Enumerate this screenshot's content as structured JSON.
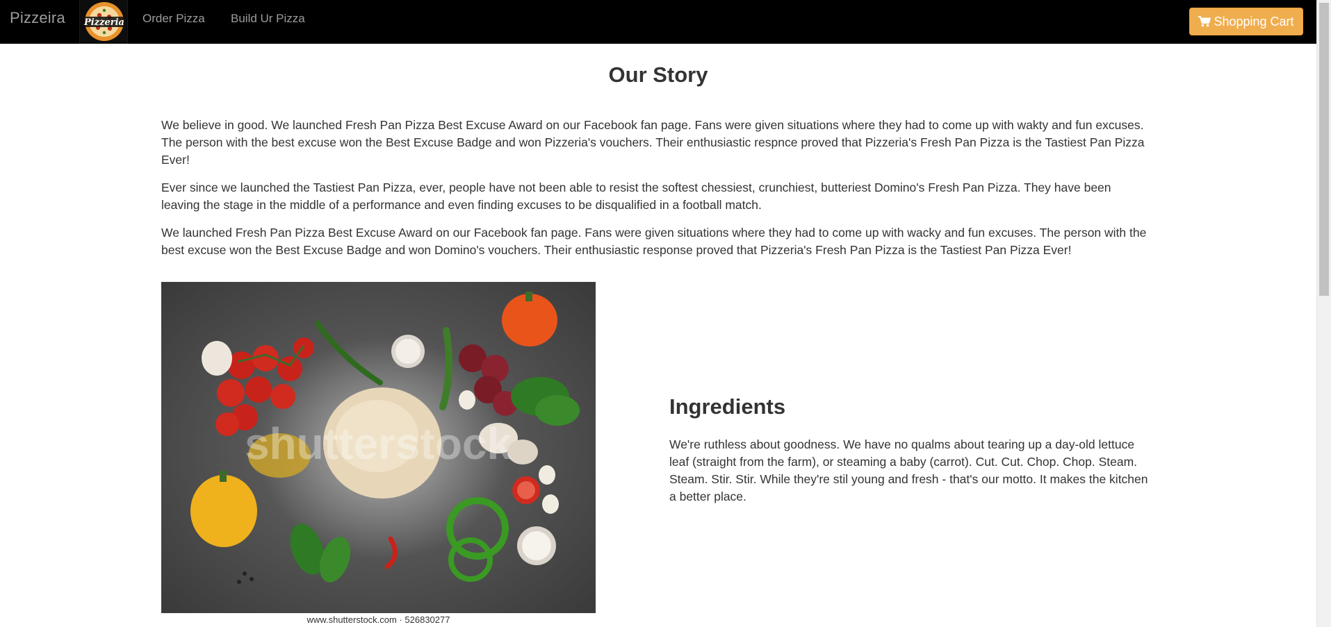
{
  "navbar": {
    "brand": "Pizzeira",
    "logo_text": "Pizzeria",
    "links": [
      "Order Pizza",
      "Build Ur Pizza"
    ],
    "cart_label": "Shopping Cart",
    "cart_icon": "shopping-cart-icon",
    "cart_color": "#f0ad4e"
  },
  "story": {
    "title": "Our Story",
    "paragraphs": [
      "We believe in good. We launched Fresh Pan Pizza Best Excuse Award on our Facebook fan page. Fans were given situations where they had to come up with wakty and fun excuses. The person with the best excuse won the Best Excuse Badge and won Pizzeria's vouchers. Their enthusiastic respnce proved that Pizzeria's Fresh Pan Pizza is the Tastiest Pan Pizza Ever!",
      "Ever since we launched the Tastiest Pan Pizza, ever, people have not been able to resist the softest chessiest, crunchiest, butteriest Domino's Fresh Pan Pizza. They have been leaving the stage in the middle of a performance and even finding excuses to be disqualified in a football match.",
      "We launched Fresh Pan Pizza Best Excuse Award on our Facebook fan page. Fans were given situations where they had to come up with wacky and fun excuses. The person with the best excuse won the Best Excuse Badge and won Domino's vouchers. Their enthusiastic response proved that Pizzeria's Fresh Pan Pizza is the Tastiest Pan Pizza Ever!"
    ]
  },
  "ingredients": {
    "title": "Ingredients",
    "text": "We're ruthless about goodness. We have no qualms about tearing up a day-old lettuce leaf (straight from the farm), or steaming a baby (carrot). Cut. Cut. Chop. Chop. Steam. Steam. Stir. Stir. While they're stil young and fresh - that's our motto. It makes the kitchen a better place.",
    "image_watermark": "shutterstock",
    "image_caption": "www.shutterstock.com · 526830277"
  }
}
